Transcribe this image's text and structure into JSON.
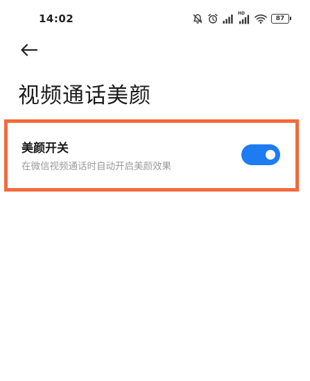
{
  "status_bar": {
    "time": "14:02",
    "icons": [
      "mute-bell-icon",
      "alarm-icon",
      "signal-icon",
      "hd-signal-icon",
      "wifi-icon",
      "battery-icon"
    ],
    "hd_label": "HD",
    "battery_level": "87"
  },
  "header": {
    "back_icon": "arrow-left-icon",
    "title": "视频通话美颜"
  },
  "setting": {
    "label": "美颜开关",
    "description": "在微信视频通话时自动开启美颜效果",
    "enabled": true
  },
  "colors": {
    "accent": "#1e7cf2",
    "highlight_border": "#f26a3d",
    "description_text": "#9a9a9a",
    "background": "#ffffff"
  }
}
